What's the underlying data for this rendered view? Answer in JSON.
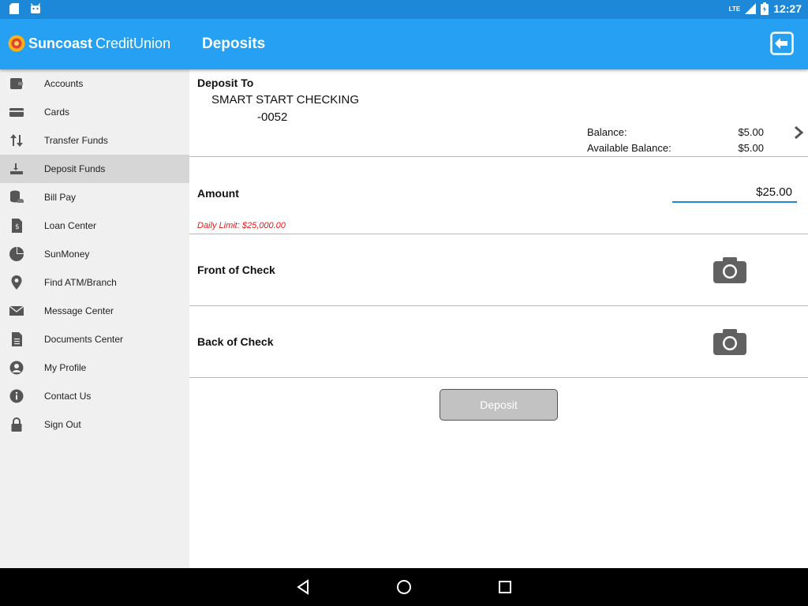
{
  "status_bar": {
    "network": "LTE",
    "time": "12:27"
  },
  "app_bar": {
    "brand_bold": "Suncoast",
    "brand_light": "CreditUnion",
    "title": "Deposits",
    "logout_icon": "logout-icon"
  },
  "sidebar": {
    "items": [
      {
        "label": "Accounts",
        "icon": "wallet-icon"
      },
      {
        "label": "Cards",
        "icon": "card-icon"
      },
      {
        "label": "Transfer Funds",
        "icon": "transfer-arrows-icon"
      },
      {
        "label": "Deposit Funds",
        "icon": "deposit-tray-icon",
        "active": true
      },
      {
        "label": "Bill Pay",
        "icon": "coins-icon"
      },
      {
        "label": "Loan Center",
        "icon": "document-dollar-icon"
      },
      {
        "label": "SunMoney",
        "icon": "pie-chart-icon"
      },
      {
        "label": "Find ATM/Branch",
        "icon": "map-pin-icon"
      },
      {
        "label": "Message Center",
        "icon": "envelope-icon"
      },
      {
        "label": "Documents Center",
        "icon": "document-icon"
      },
      {
        "label": "My Profile",
        "icon": "user-icon"
      },
      {
        "label": "Contact Us",
        "icon": "info-icon"
      },
      {
        "label": "Sign Out",
        "icon": "lock-icon"
      }
    ]
  },
  "deposit_to": {
    "label": "Deposit To",
    "account_name": "SMART START CHECKING",
    "account_number": "-0052",
    "balance_label": "Balance:",
    "balance_value": "$5.00",
    "available_label": "Available Balance:",
    "available_value": "$5.00"
  },
  "amount": {
    "label": "Amount",
    "value": "$25.00",
    "daily_limit": "Daily Limit: $25,000.00"
  },
  "front_check": {
    "label": "Front of Check"
  },
  "back_check": {
    "label": "Back of Check"
  },
  "deposit_button": {
    "label": "Deposit"
  },
  "colors": {
    "app_bar": "#26a0f2",
    "status_bar": "#1e88d8",
    "limit_text": "#e21b1b",
    "button_disabled": "#c2c2c2"
  }
}
